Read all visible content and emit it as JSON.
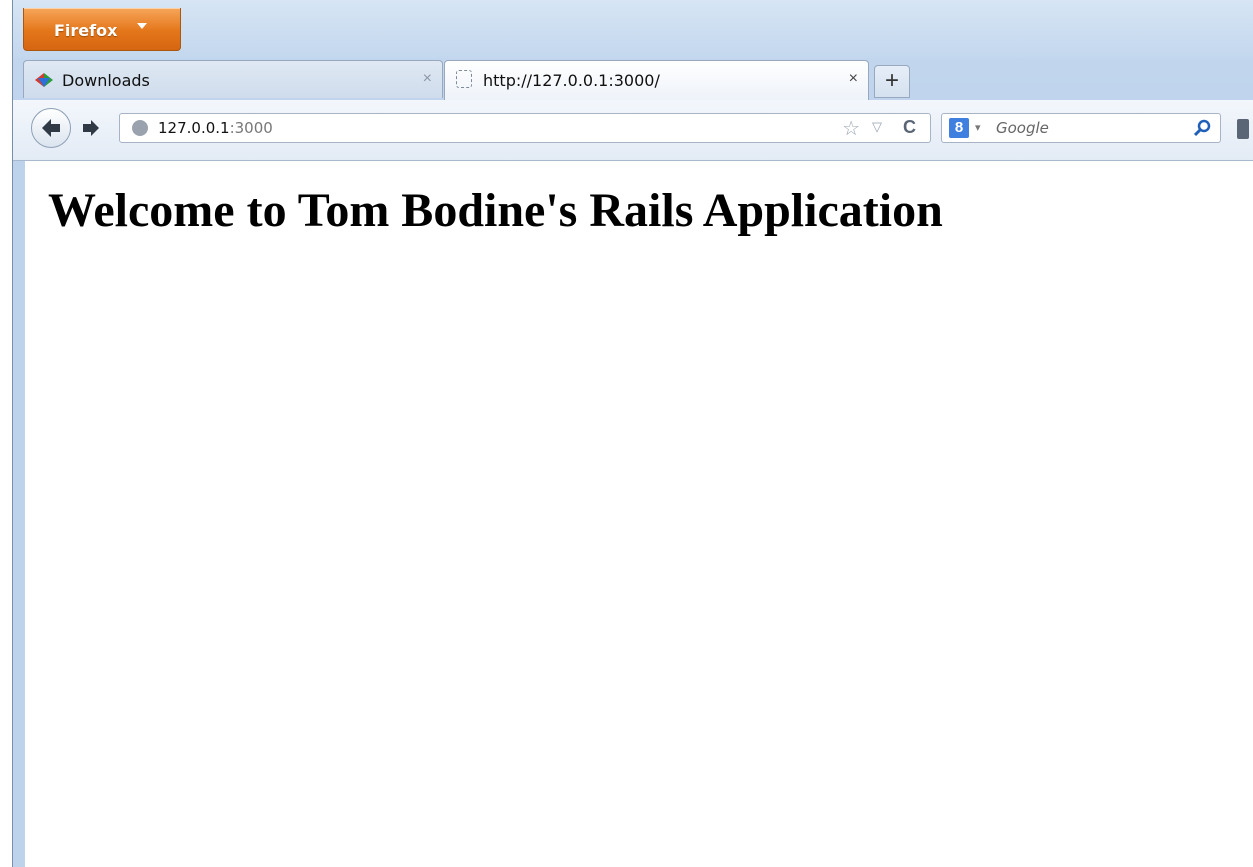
{
  "menu_button": {
    "label": "Firefox"
  },
  "tabs": [
    {
      "label": "Downloads",
      "active": false
    },
    {
      "label": "http://127.0.0.1:3000/",
      "active": true
    }
  ],
  "close_glyph": "×",
  "newtab_glyph": "+",
  "url": {
    "host": "127.0.0.1",
    "port": ":3000"
  },
  "search": {
    "engine_letter": "8",
    "placeholder": "Google"
  },
  "icons": {
    "globe": "globe-icon",
    "star": "star-icon",
    "reload": "reload-icon",
    "search": "magnifier-icon"
  },
  "page": {
    "heading": "Welcome to Tom Bodine's Rails Application"
  },
  "colors": {
    "firefox_orange": "#e4761a",
    "chrome_blue": "#c4d8ee"
  }
}
